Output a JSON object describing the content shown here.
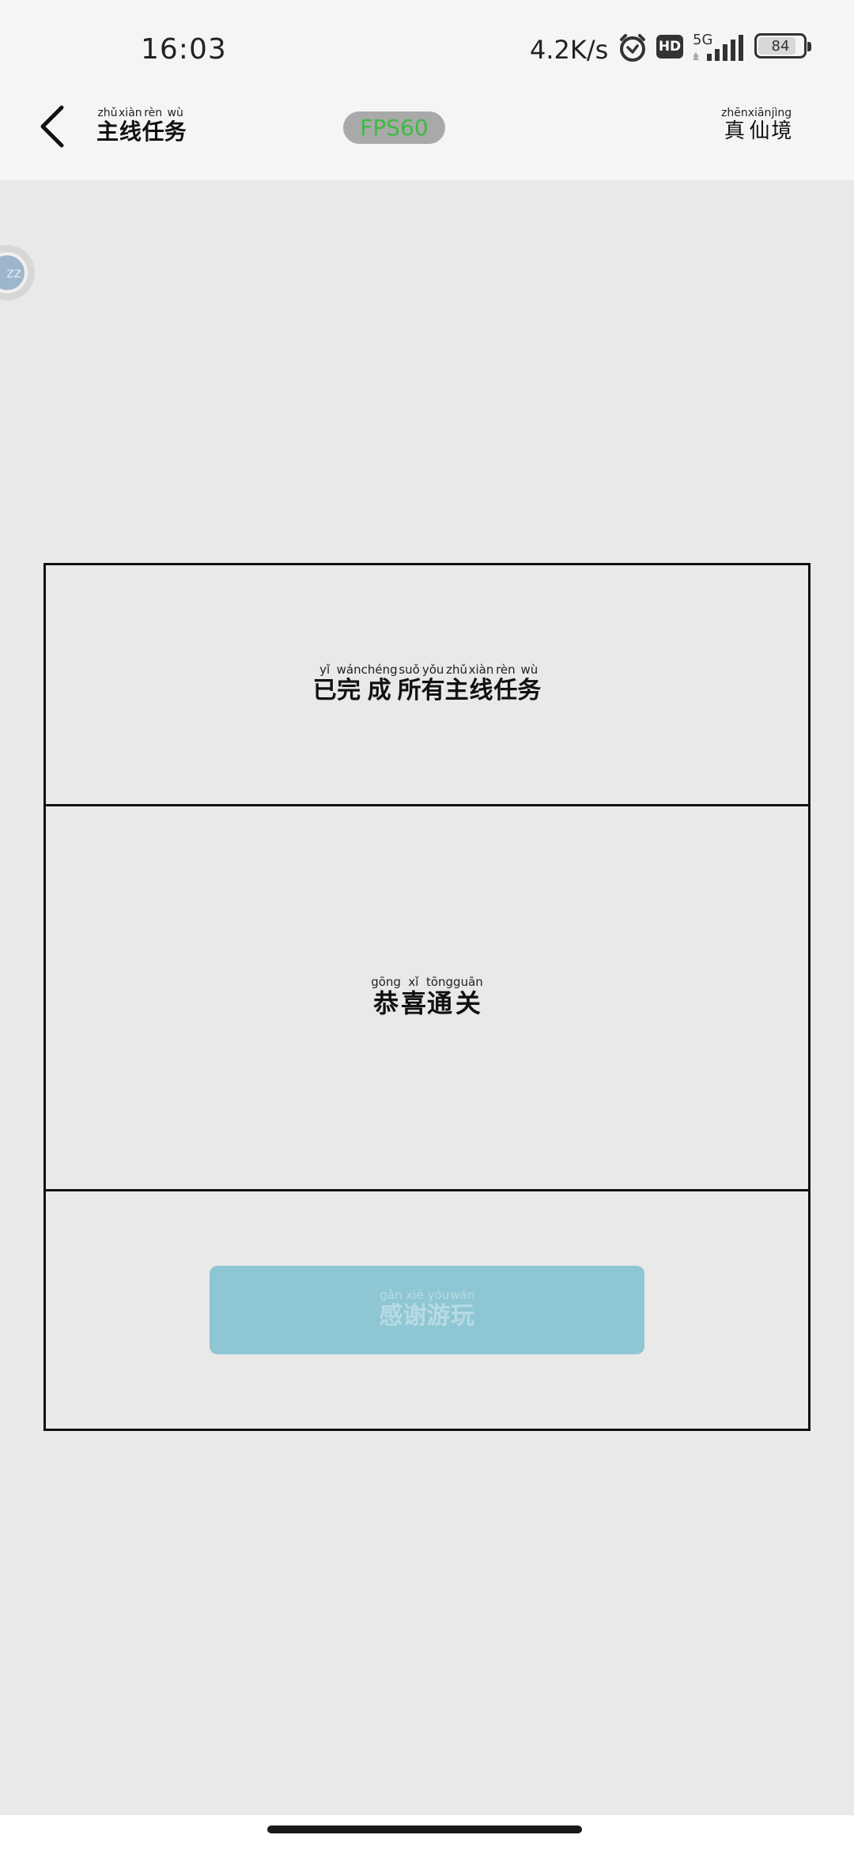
{
  "status_bar": {
    "time": "16:03",
    "net_speed": "4.2K/s",
    "hd_badge": "HD",
    "network_type": "5G",
    "battery": "84",
    "battery_level": 0.84
  },
  "nav": {
    "back_icon": "chevron-left-icon",
    "title_chars": [
      {
        "han": "主",
        "py": "zhǔ"
      },
      {
        "han": "线",
        "py": "xiàn"
      },
      {
        "han": "任",
        "py": "rèn"
      },
      {
        "han": "务",
        "py": "wù"
      }
    ],
    "fps": "FPS60",
    "realm_chars": [
      {
        "han": "真",
        "py": "zhēn"
      },
      {
        "han": "仙",
        "py": "xiān"
      },
      {
        "han": "境",
        "py": "jìng"
      }
    ]
  },
  "float_ball": {
    "label": "zz",
    "icon": "floating-assistant-icon"
  },
  "dialog": {
    "completed_chars": [
      {
        "han": "已",
        "py": "yǐ"
      },
      {
        "han": "完",
        "py": "wán"
      },
      {
        "han": "成",
        "py": "chéng"
      },
      {
        "han": "所",
        "py": "suǒ"
      },
      {
        "han": "有",
        "py": "yǒu"
      },
      {
        "han": "主",
        "py": "zhǔ"
      },
      {
        "han": "线",
        "py": "xiàn"
      },
      {
        "han": "任",
        "py": "rèn"
      },
      {
        "han": "务",
        "py": "wù"
      }
    ],
    "congrats_chars": [
      {
        "han": "恭",
        "py": "gōng"
      },
      {
        "han": "喜",
        "py": "xǐ"
      },
      {
        "han": "通",
        "py": "tōng"
      },
      {
        "han": "关",
        "py": "guān"
      }
    ],
    "thanks_chars": [
      {
        "han": "感",
        "py": "gǎn"
      },
      {
        "han": "谢",
        "py": "xiè"
      },
      {
        "han": "游",
        "py": "yóu"
      },
      {
        "han": "玩",
        "py": "wán"
      }
    ]
  },
  "colors": {
    "background": "#e9e9e9",
    "header": "#f5f5f5",
    "fps_text": "#3dbb43",
    "fps_bg": "#a9a9a9",
    "button_bg": "#8fc6d3",
    "button_text": "#b7dbe3"
  }
}
